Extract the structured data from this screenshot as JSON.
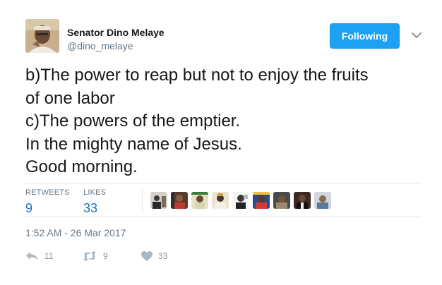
{
  "author": {
    "display_name": "Senator Dino Melaye",
    "username": "@dino_melaye",
    "avatar_icon": "profile-photo"
  },
  "follow_button": {
    "label": "Following",
    "color": "#1da1f2"
  },
  "menu": {
    "icon": "chevron-down-icon"
  },
  "tweet": {
    "lines": [
      "b)The power to reap but not to enjoy the fruits",
      "of one labor",
      "c)The powers of the emptier.",
      "In the mighty name of Jesus.",
      "Good morning."
    ]
  },
  "stats": {
    "retweets": {
      "label": "RETWEETS",
      "value": "9"
    },
    "likes": {
      "label": "LIKES",
      "value": "33"
    }
  },
  "likers_count_shown": 9,
  "timestamp": "1:52 AM - 26 Mar 2017",
  "actions": {
    "reply": {
      "icon": "reply-icon",
      "count": "11"
    },
    "retweet": {
      "icon": "retweet-icon",
      "count": "9"
    },
    "like": {
      "icon": "heart-icon",
      "count": "33"
    }
  }
}
